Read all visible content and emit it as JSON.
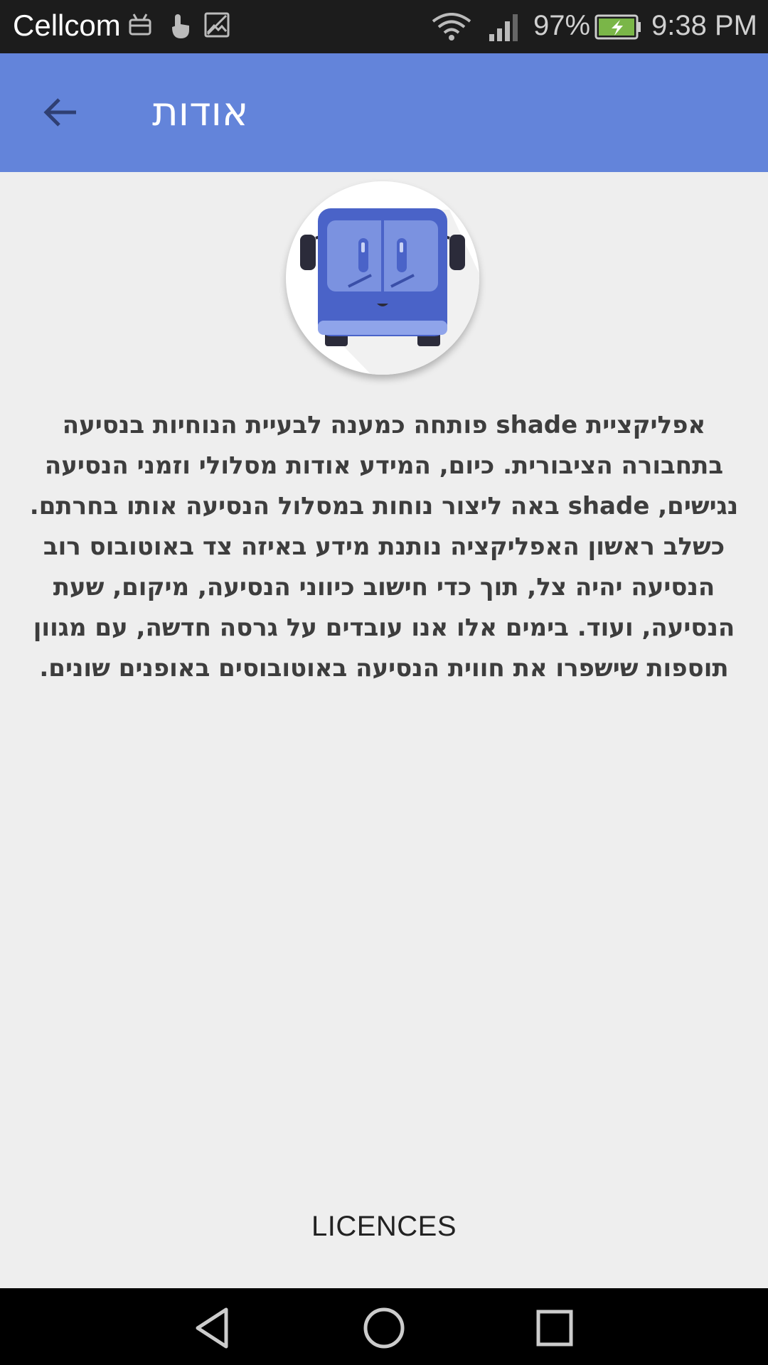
{
  "status_bar": {
    "carrier": "Cellcom",
    "battery_percent": "97%",
    "time": "9:38 PM",
    "icons": [
      "android-debug-icon",
      "touch-icon",
      "image-icon",
      "wifi-icon",
      "signal-icon",
      "battery-charging-icon"
    ]
  },
  "app_bar": {
    "title": "אודות",
    "back_icon": "arrow-back-icon",
    "color": "#6384da"
  },
  "logo": {
    "icon": "bus-logo-icon"
  },
  "about": {
    "text": "אפליקציית shade פותחה כמענה לבעיית הנוחיות בנסיעה בתחבורה הציבורית. כיום, המידע אודות מסלולי וזמני הנסיעה נגישים, shade באה ליצור נוחות במסלול הנסיעה אותו בחרתם. כשלב ראשון האפליקציה נותנת מידע באיזה צד באוטובוס רוב הנסיעה יהיה צל, תוך כדי חישוב כיווני הנסיעה, מיקום, שעת הנסיעה, ועוד. בימים אלו אנו עובדים על גרסה חדשה, עם מגוון תוספות שישפרו את חווית הנסיעה באוטובוסים באופנים שונים."
  },
  "licences_button": {
    "label": "LICENCES"
  },
  "nav_bar": {
    "back": "nav-back-icon",
    "home": "nav-home-icon",
    "recents": "nav-recents-icon"
  }
}
